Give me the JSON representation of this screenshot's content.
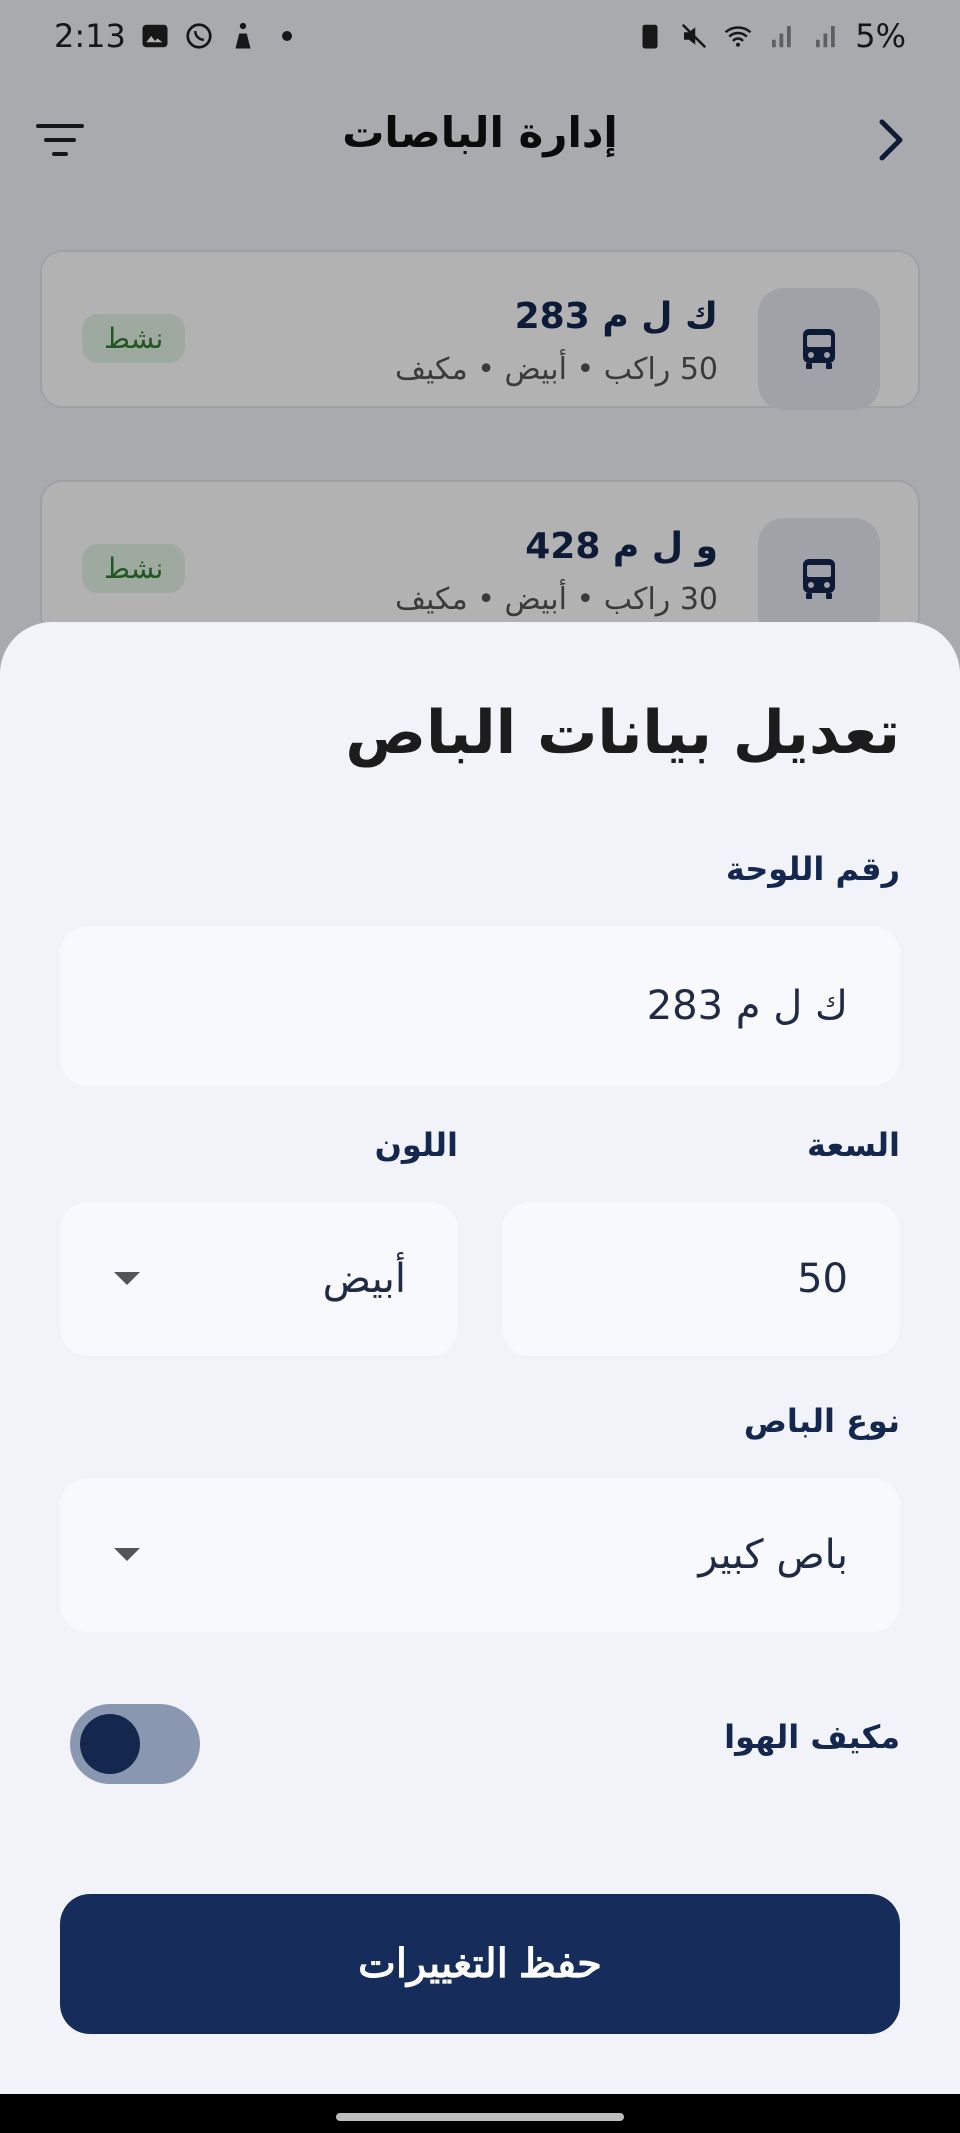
{
  "status_bar": {
    "time": "2:13",
    "battery": "5%",
    "left_icons": [
      "gallery-icon",
      "whatsapp-icon",
      "accessibility-icon",
      "dot-icon"
    ],
    "right_icons": [
      "battery-saver-icon",
      "mute-icon",
      "wifi-icon",
      "signal-icon",
      "signal-icon"
    ]
  },
  "app_bar": {
    "title": "إدارة الباصات",
    "back_icon": "chevron-right-icon",
    "filter_icon": "filter-icon"
  },
  "bus_list": [
    {
      "plate": "ك ل م 283",
      "meta": "50 راكب • أبيض • مكيف",
      "status": "نشط"
    },
    {
      "plate": "و ل م 428",
      "meta": "30 راكب • أبيض • مكيف",
      "status": "نشط"
    }
  ],
  "sheet": {
    "title": "تعديل بيانات الباص",
    "plate_label": "رقم اللوحة",
    "plate_value": "ك ل م 283",
    "capacity_label": "السعة",
    "capacity_value": "50",
    "color_label": "اللون",
    "color_value": "أبيض",
    "type_label": "نوع الباص",
    "type_value": "باص كبير",
    "ac_label": "مكيف الهوا",
    "ac_enabled": true,
    "save_label": "حفظ التغييرات"
  },
  "colors": {
    "primary": "#162c5b",
    "active_badge_bg": "#e2f2e4",
    "active_badge_text": "#2e7d32"
  }
}
